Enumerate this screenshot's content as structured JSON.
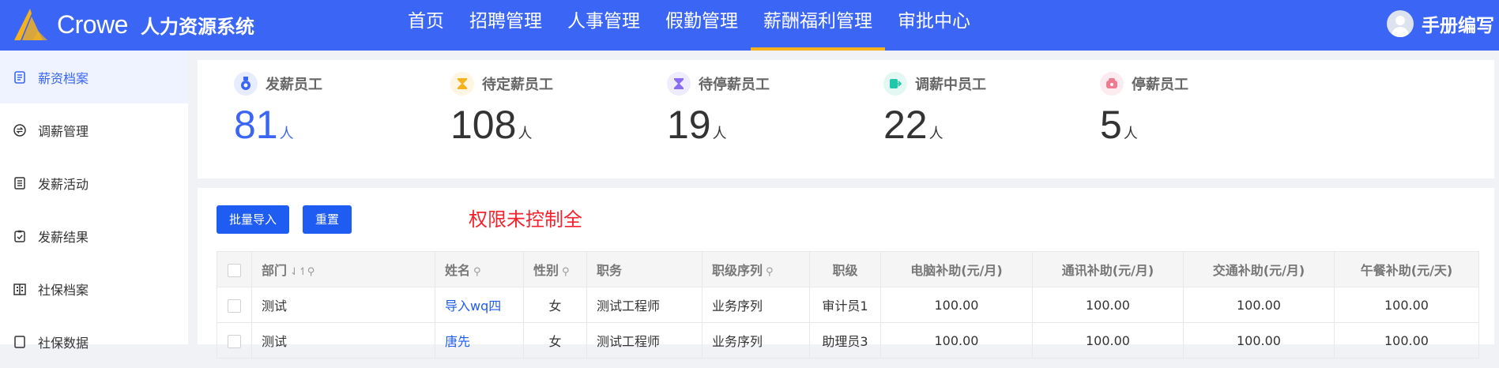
{
  "header": {
    "brand": "Crowe",
    "system_name": "人力资源系统",
    "nav": [
      "首页",
      "招聘管理",
      "人事管理",
      "假勤管理",
      "薪酬福利管理",
      "审批中心"
    ],
    "active_nav_index": 4,
    "user_name": "手册编写",
    "colors": {
      "bar": "#3b66f5",
      "accent": "#f5b21d"
    }
  },
  "sidebar": {
    "items": [
      {
        "label": "薪资档案",
        "icon": "document-icon",
        "active": true
      },
      {
        "label": "调薪管理",
        "icon": "exchange-icon",
        "active": false
      },
      {
        "label": "发薪活动",
        "icon": "list-icon",
        "active": false
      },
      {
        "label": "发薪结果",
        "icon": "check-clipboard-icon",
        "active": false
      },
      {
        "label": "社保档案",
        "icon": "building-icon",
        "active": false
      },
      {
        "label": "社保数据",
        "icon": "data-icon",
        "active": false
      }
    ]
  },
  "stats": [
    {
      "label": "发薪员工",
      "value": "81",
      "unit": "人",
      "icon": "medal-icon",
      "icon_color": "#3b66f5",
      "icon_bg": "#e7edff"
    },
    {
      "label": "待定薪员工",
      "value": "108",
      "unit": "人",
      "icon": "hourglass-icon",
      "icon_color": "#f5b21d",
      "icon_bg": "#fff5e3"
    },
    {
      "label": "待停薪员工",
      "value": "19",
      "unit": "人",
      "icon": "hourglass-icon",
      "icon_color": "#8a6cf0",
      "icon_bg": "#f0ecff"
    },
    {
      "label": "调薪中员工",
      "value": "22",
      "unit": "人",
      "icon": "transfer-icon",
      "icon_color": "#1fc8a8",
      "icon_bg": "#e3f8f3"
    },
    {
      "label": "停薪员工",
      "value": "5",
      "unit": "人",
      "icon": "wallet-icon",
      "icon_color": "#f07a8f",
      "icon_bg": "#fdecef"
    }
  ],
  "toolbar": {
    "batch_import": "批量导入",
    "reset": "重置",
    "warning": "权限未控制全"
  },
  "table": {
    "columns": [
      "部门",
      "姓名",
      "性别",
      "职务",
      "职级序列",
      "职级",
      "电脑补助(元/月)",
      "通讯补助(元/月)",
      "交通补助(元/月)",
      "午餐补助(元/天)"
    ],
    "rows": [
      [
        "测试",
        "导入wq四",
        "女",
        "测试工程师",
        "业务序列",
        "审计员1",
        "100.00",
        "100.00",
        "100.00",
        "100.00"
      ],
      [
        "测试",
        "唐先",
        "女",
        "测试工程师",
        "业务序列",
        "助理员3",
        "100.00",
        "100.00",
        "100.00",
        "100.00"
      ]
    ]
  }
}
